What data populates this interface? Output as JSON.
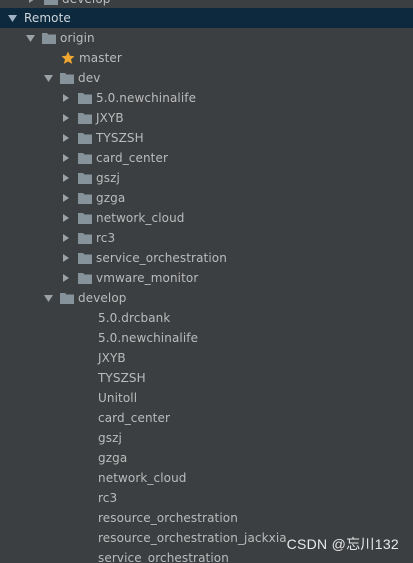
{
  "tree": {
    "partial_top_label": "develop",
    "remote_label": "Remote",
    "origin_label": "origin",
    "master_label": "master",
    "dev": {
      "label": "dev",
      "folders": [
        "5.0.newchinalife",
        "JXYB",
        "TYSZSH",
        "card_center",
        "gszj",
        "gzga",
        "network_cloud",
        "rc3",
        "service_orchestration",
        "vmware_monitor"
      ]
    },
    "develop": {
      "label": "develop",
      "branches": [
        "5.0.drcbank",
        "5.0.newchinalife",
        "JXYB",
        "TYSZSH",
        "Unitoll",
        "card_center",
        "gszj",
        "gzga",
        "network_cloud",
        "rc3",
        "resource_orchestration",
        "resource_orchestration_jackxia",
        "service_orchestration"
      ]
    }
  },
  "watermark": "CSDN @忘川132",
  "colors": {
    "background": "#3c3f41",
    "selection": "#0d293e",
    "text": "#bbbbbb",
    "folder": "#87939a",
    "star": "#f0a732"
  },
  "icons": {
    "expanded": "chevron-down-icon",
    "collapsed": "chevron-right-icon",
    "folder": "folder-icon",
    "favorite": "star-icon"
  }
}
